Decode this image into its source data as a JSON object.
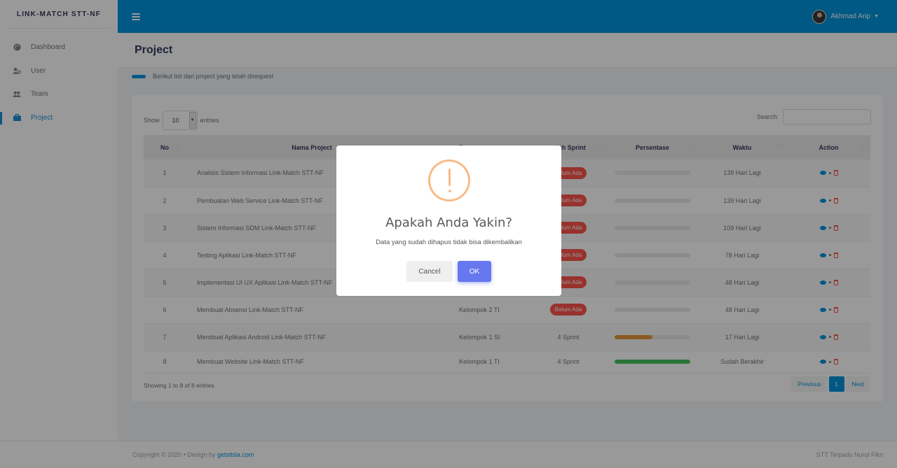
{
  "sidebar": {
    "brand": "LINK-MATCH STT-NF",
    "items": [
      {
        "label": "Dashboard",
        "icon": "palette-icon"
      },
      {
        "label": "User",
        "icon": "users-cog-icon"
      },
      {
        "label": "Team",
        "icon": "users-icon"
      },
      {
        "label": "Project",
        "icon": "briefcase-icon",
        "active": true
      }
    ]
  },
  "topbar": {
    "user_name": "Akhmad Arip"
  },
  "page": {
    "title": "Project",
    "info": "Berikut list dari project yang telah direquest"
  },
  "table_controls": {
    "show_label": "Show",
    "entries_value": "10",
    "entries_label": "entries",
    "search_label": "Search:"
  },
  "table": {
    "headers": [
      "No",
      "Nama Project",
      "T",
      "mlah Sprint",
      "Persentase",
      "Waktu",
      "Action"
    ],
    "rows": [
      {
        "no": "1",
        "name": "Analisis Sistem Informasi Link-Match STT-NF",
        "team": "",
        "sprint": "Belum Ada",
        "sprint_badge": true,
        "progress": 0,
        "time": "139 Hari Lagi"
      },
      {
        "no": "2",
        "name": "Pembuatan Web Service Link-Match STT-NF",
        "team": "",
        "sprint": "Belum Ada",
        "sprint_badge": true,
        "progress": 0,
        "time": "139 Hari Lagi"
      },
      {
        "no": "3",
        "name": "Sistem Informasi SDM Link-Match STT-NF",
        "team": "",
        "sprint": "Belum Ada",
        "sprint_badge": true,
        "progress": 0,
        "time": "109 Hari Lagi"
      },
      {
        "no": "4",
        "name": "Testing Aplikasi Link-Match STT-NF",
        "team": "",
        "sprint": "Belum Ada",
        "sprint_badge": true,
        "progress": 0,
        "time": "78 Hari Lagi"
      },
      {
        "no": "5",
        "name": "Implementasi UI UX Aplikasi Link-Match STT-NF",
        "team": "",
        "sprint": "Belum Ada",
        "sprint_badge": true,
        "progress": 0,
        "time": "48 Hari Lagi"
      },
      {
        "no": "6",
        "name": "Membuat Absensi Link-Match STT-NF",
        "team": "Kelompok 2 TI",
        "sprint": "Belum Ada",
        "sprint_badge": true,
        "progress": 0,
        "time": "48 Hari Lagi"
      },
      {
        "no": "7",
        "name": "Membuat Aplikasi Android Link-Match STT-NF",
        "team": "Kelompok 1 SI",
        "sprint": "4 Sprint",
        "sprint_badge": false,
        "progress": 50,
        "progress_color": "#e8963a",
        "time": "17 Hari Lagi"
      },
      {
        "no": "8",
        "name": "Membuat Website Link-Match STT-NF",
        "team": "Kelompok 1 TI",
        "sprint": "4 Sprint",
        "sprint_badge": false,
        "progress": 100,
        "progress_color": "#47c363",
        "time": "Sudah Berakhir"
      }
    ]
  },
  "pagination": {
    "showing": "Showing 1 to 8 of 8 entries",
    "previous": "Previous",
    "current": "1",
    "next": "Next"
  },
  "footer": {
    "copyright": "Copyright © 2020",
    "design_by": "Design by",
    "design_link": "getstisla.com",
    "right": "STT Terpadu Nurul Fikri"
  },
  "modal": {
    "title": "Apakah Anda Yakin?",
    "text": "Data yang sudah dihapus tidak bisa dikembalikan",
    "cancel": "Cancel",
    "ok": "OK"
  },
  "colors": {
    "primary": "#0093dd",
    "danger": "#fc544b",
    "confirm": "#6777ef",
    "warning_icon": "#f8bb86"
  }
}
